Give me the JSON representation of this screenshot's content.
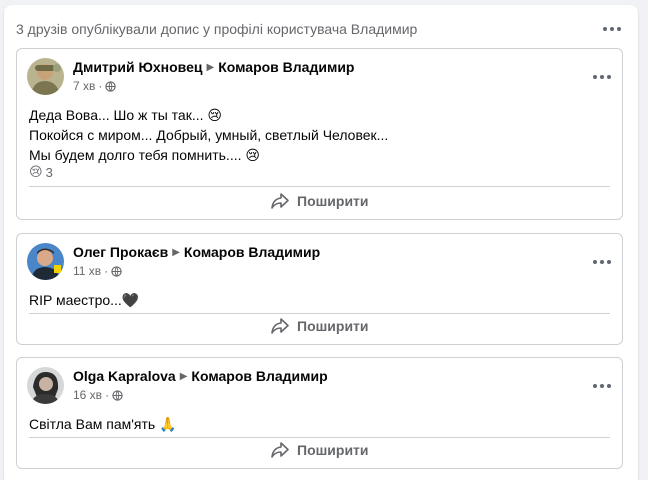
{
  "panel": {
    "title": "3 друзів опублікували допис у профілі користувача Владимир"
  },
  "posts": [
    {
      "author": "Дмитрий Юхновец",
      "target": "Комаров Владимир",
      "time": "7 хв",
      "lines": [
        "Деда Вова... Шо ж ты так... 😢",
        "Покойся с миром... Добрый, умный, светлый Человек...",
        "Мы будем долго тебя помнить.... 😢"
      ],
      "reaction_emoji": "😢",
      "reaction_count": "3",
      "share_label": "Поширити"
    },
    {
      "author": "Олег Прокаєв",
      "target": "Комаров Владимир",
      "time": "11 хв",
      "lines": [
        "RIP маестро...🖤"
      ],
      "share_label": "Поширити"
    },
    {
      "author": "Olga Kapralova",
      "target": "Комаров Владимир",
      "time": "16 хв",
      "lines": [
        "Світла Вам пам'ять 🙏"
      ],
      "share_label": "Поширити"
    }
  ],
  "icons": {
    "more": "more-dots-icon",
    "share": "share-arrow-icon",
    "audience": "globe-icon",
    "separator": "triangle-right-icon"
  },
  "colors": {
    "page_bg": "#f0f2f5",
    "card_bg": "#ffffff",
    "secondary_text": "#65676b",
    "border": "#ced0d4"
  }
}
